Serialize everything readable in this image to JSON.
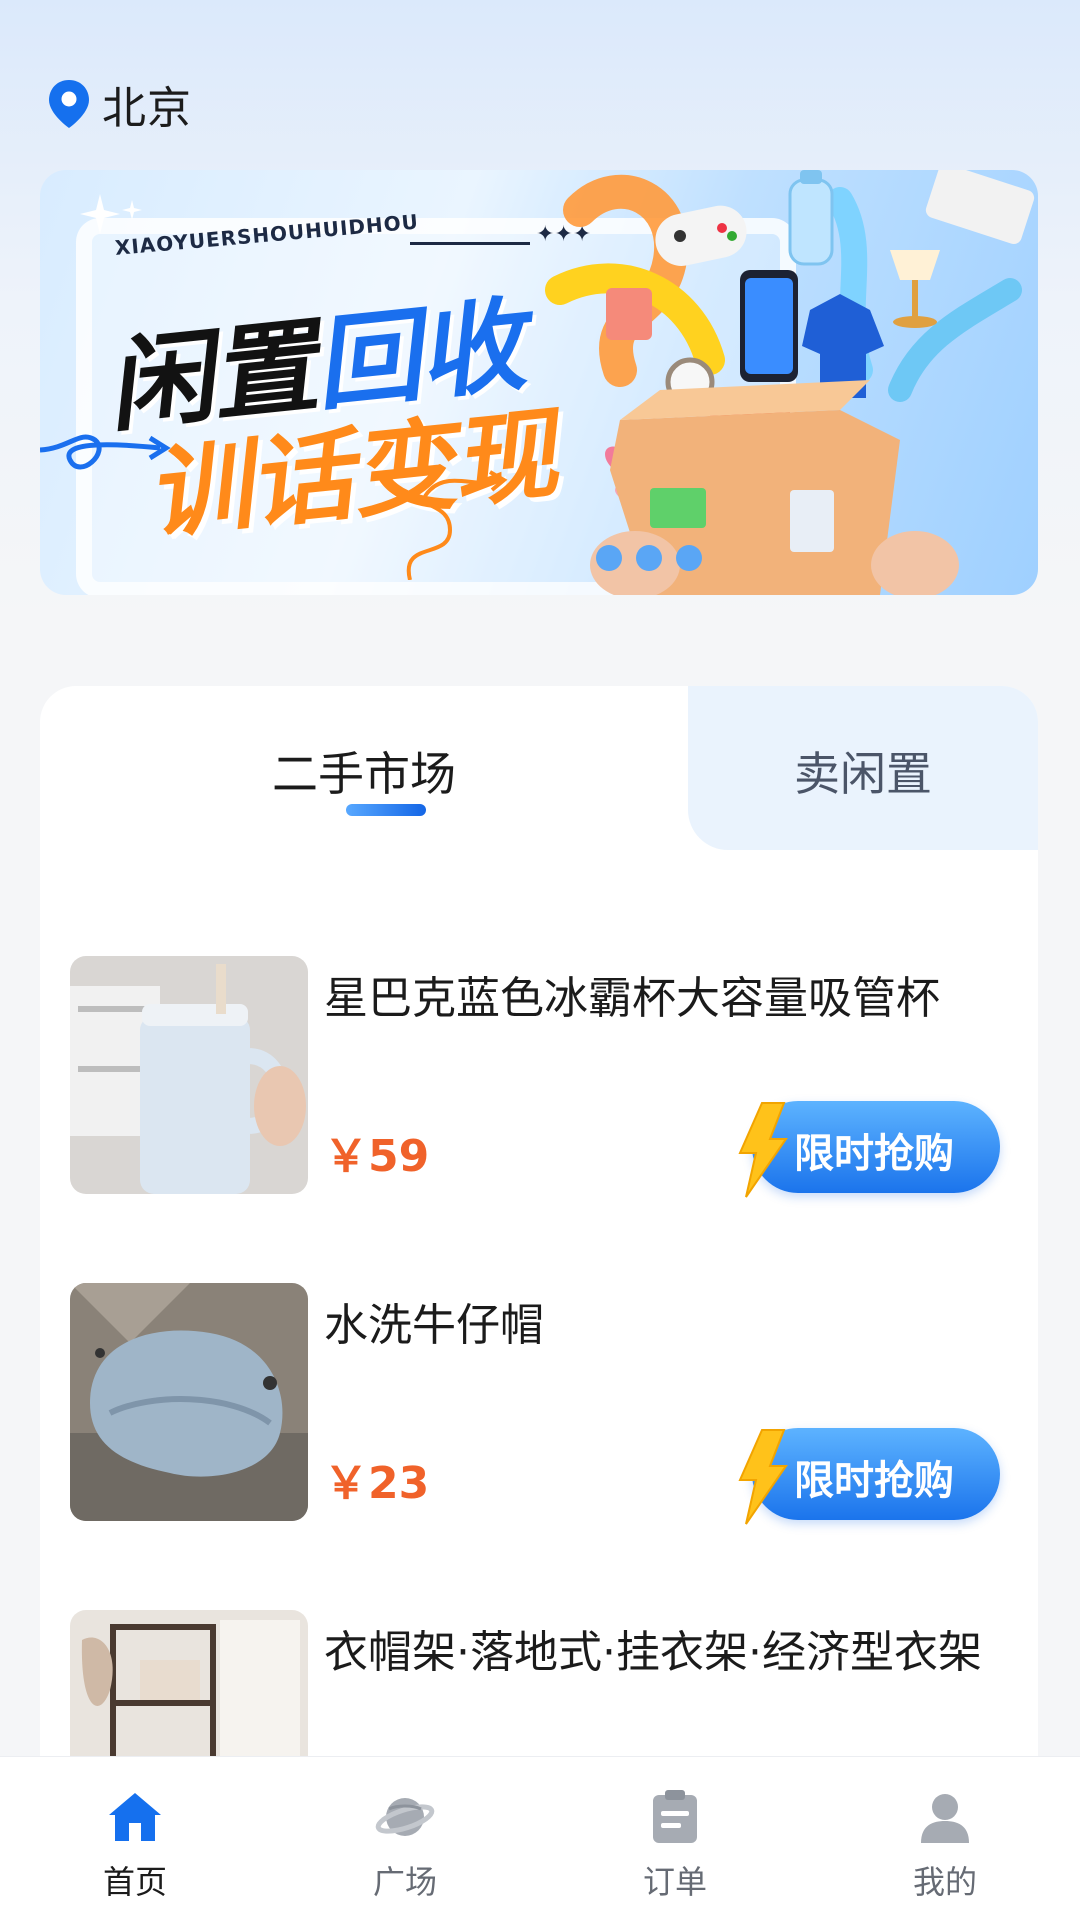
{
  "location": {
    "city": "北京"
  },
  "banner": {
    "subtitle": "XIAOYUERSHOUHUIDHOU",
    "headline_part1": "闲置",
    "headline_part2": "回收",
    "headline_line2": "训话变现"
  },
  "tabs": {
    "active": "二手市场",
    "inactive": "卖闲置"
  },
  "items": [
    {
      "title": "星巴克蓝色冰霸杯大容量吸管杯",
      "price": "￥59",
      "button": "限时抢购"
    },
    {
      "title": "水洗牛仔帽",
      "price": "￥23",
      "button": "限时抢购"
    },
    {
      "title": "衣帽架·落地式·挂衣架·经济型衣架",
      "price": "",
      "button": ""
    }
  ],
  "tabbar": {
    "items": [
      {
        "label": "首页",
        "icon": "home-icon",
        "active": true
      },
      {
        "label": "广场",
        "icon": "planet-icon",
        "active": false
      },
      {
        "label": "订单",
        "icon": "clipboard-icon",
        "active": false
      },
      {
        "label": "我的",
        "icon": "user-icon",
        "active": false
      }
    ]
  },
  "colors": {
    "accent": "#1a6fee",
    "price": "#f0622a",
    "banner_orange": "#ff8a1a"
  }
}
